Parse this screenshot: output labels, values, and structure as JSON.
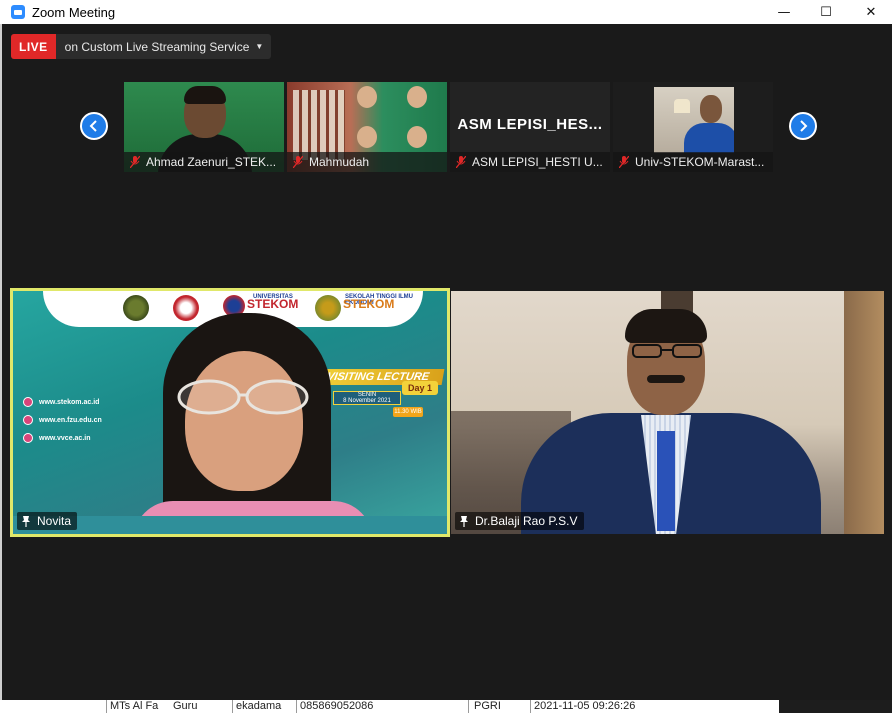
{
  "window": {
    "title": "Zoom Meeting",
    "controls": {
      "minimize": "—",
      "maximize": "☐",
      "close": "✕"
    }
  },
  "live": {
    "badge": "LIVE",
    "text": "on Custom Live Streaming Service",
    "caret": "▼"
  },
  "thumbnails": [
    {
      "name": "Ahmad Zaenuri_STEK...",
      "muted": true
    },
    {
      "name": "Mahmudah",
      "muted": true
    },
    {
      "name": "ASM LEPISI_HESTI U...",
      "display_text": "ASM  LEPISI_HES...",
      "muted": true
    },
    {
      "name": "Univ-STEKOM-Marast...",
      "muted": true
    }
  ],
  "speakers": [
    {
      "name": "Novita",
      "pinned": true,
      "active": true,
      "background": {
        "banner_left": "UNIVERSITAS",
        "banner_left_big": "STEKOM",
        "banner_right_small": "SEKOLAH TINGGI ILMU EKONOMI",
        "banner_right_big": "STEKOM",
        "banner_right_sub": "STUDI EKONOMI MODERN",
        "title": "VISITING LECTURE",
        "day": "Day 1",
        "date_line1": "SENIN",
        "date_line2": "8 November 2021",
        "time": "11.30 WIB",
        "urls": [
          "www.stekom.ac.id",
          "www.en.fzu.edu.cn",
          "www.vvce.ac.in"
        ]
      }
    },
    {
      "name": "Dr.Balaji Rao P.S.V",
      "pinned": true,
      "active": false
    }
  ],
  "background_sheet": {
    "cells": [
      "MTs Al Fa",
      "Guru",
      "ekadama",
      "085869052086",
      "PGRI",
      "2021-11-05 09:26:26"
    ]
  },
  "colors": {
    "live_red": "#e02828",
    "nav_blue": "#1f7ce8",
    "active_border": "#e0e86a",
    "meeting_bg": "#1a1a1a",
    "muted_red": "#e02828"
  }
}
